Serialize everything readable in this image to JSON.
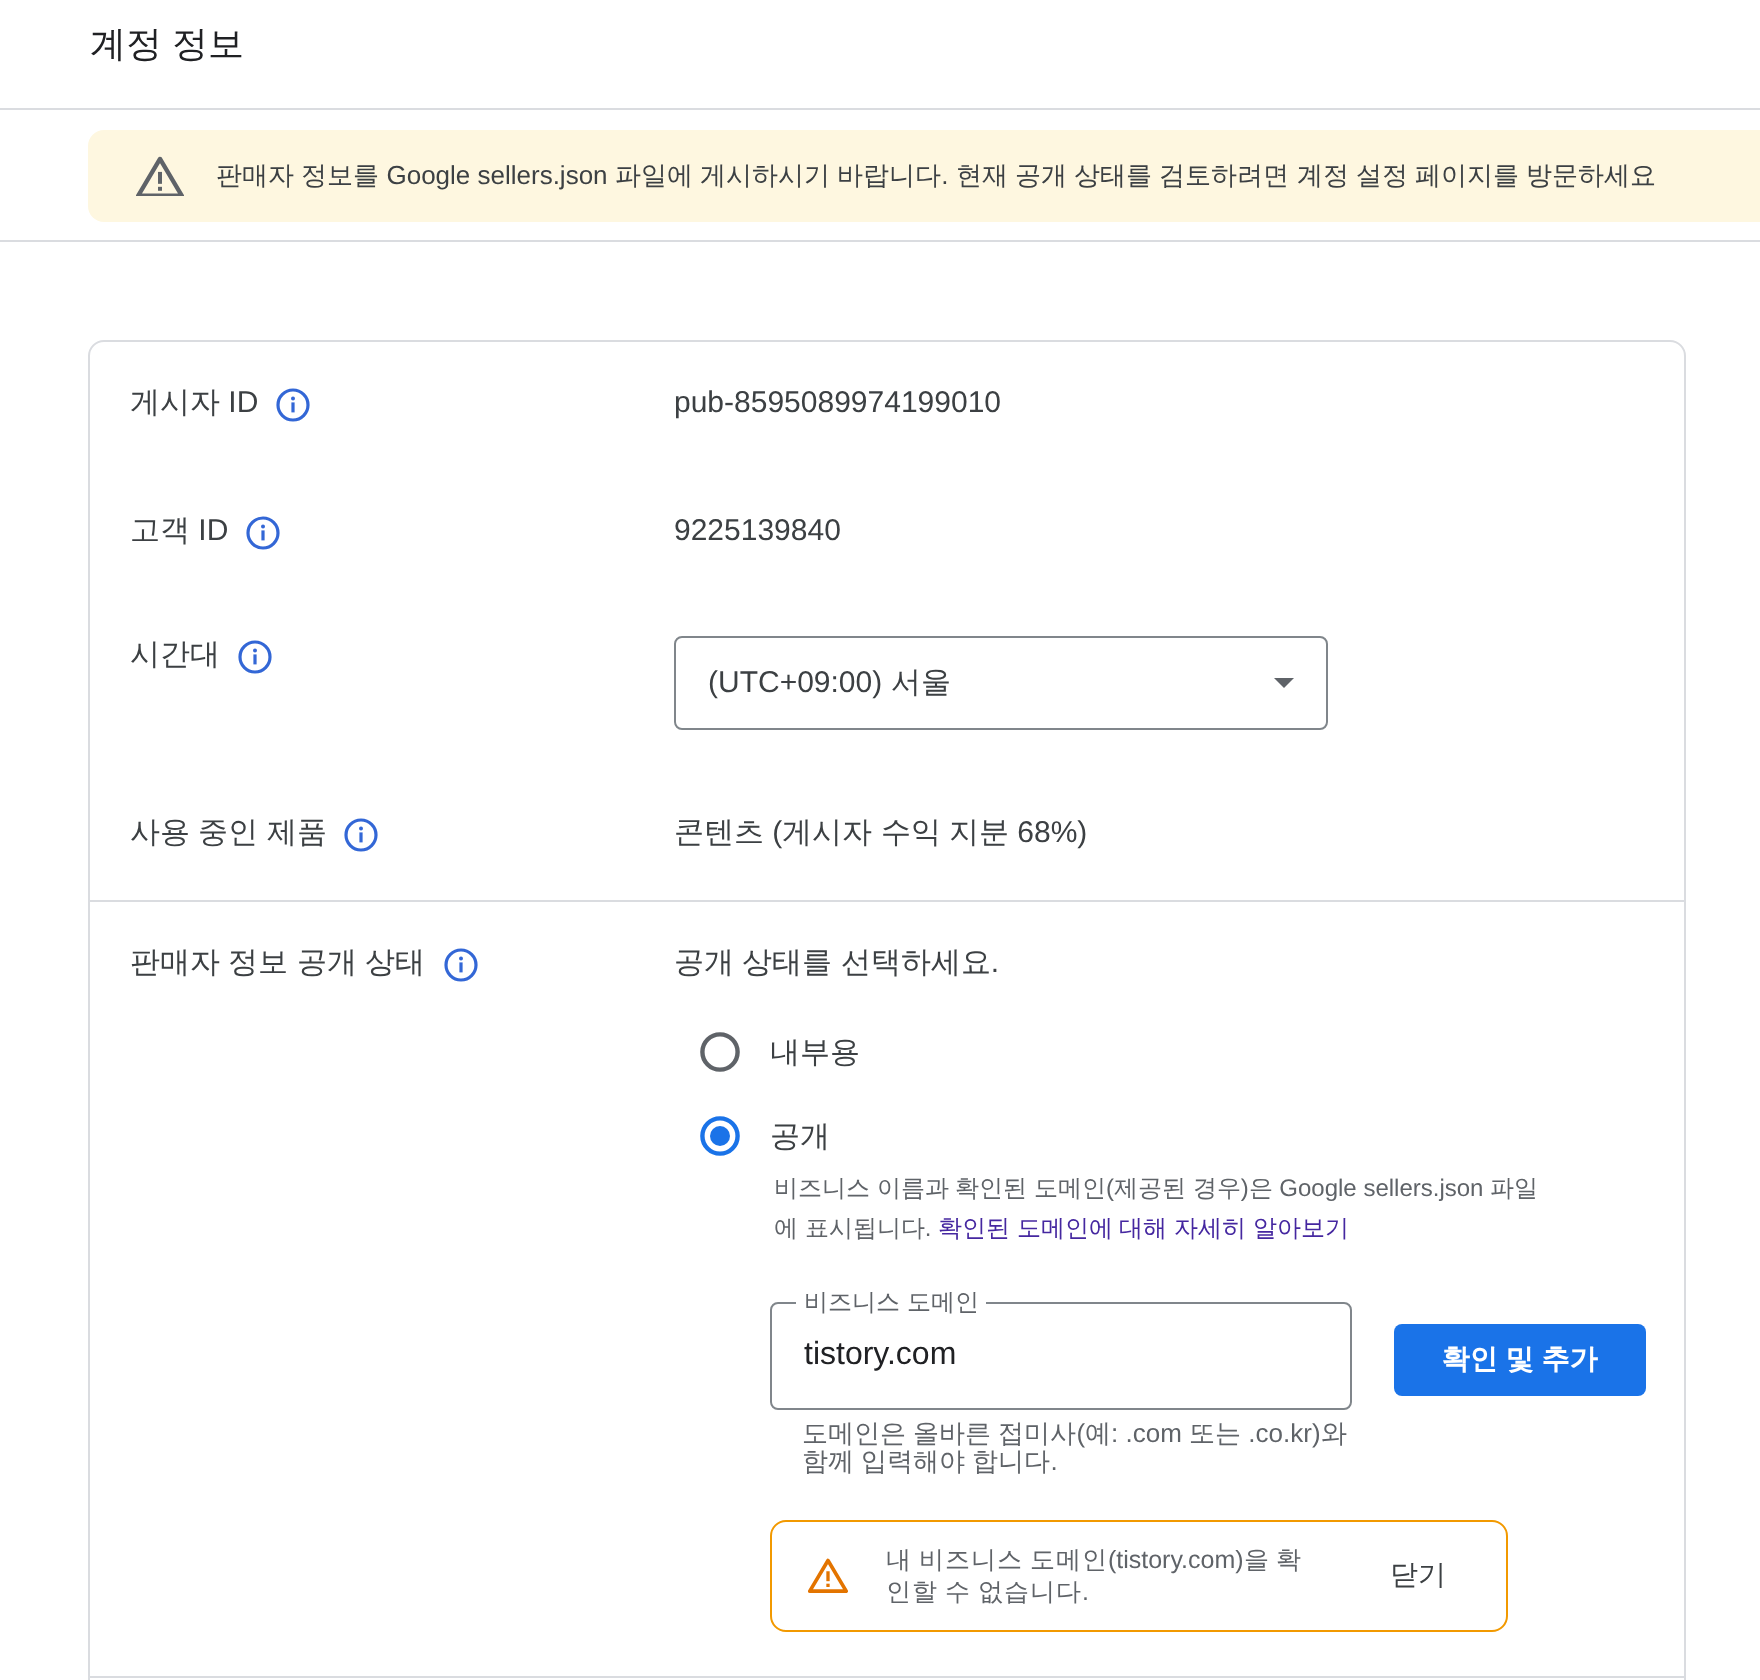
{
  "page": {
    "title": "계정 정보"
  },
  "banner": {
    "text": "판매자 정보를 Google sellers.json 파일에 게시하시기 바랍니다. 현재 공개 상태를 검토하려면 계정 설정 페이지를 방문하세요"
  },
  "info_rows": [
    {
      "label": "게시자 ID",
      "kind": "text",
      "value": "pub-8595089974199010"
    },
    {
      "label": "고객 ID",
      "kind": "text",
      "value": "9225139840"
    },
    {
      "label": "시간대",
      "kind": "select",
      "value": "(UTC+09:00) 서울"
    },
    {
      "label": "사용 중인 제품",
      "kind": "text",
      "value": "콘텐츠 (게시자 수익 지분 68%)"
    }
  ],
  "seller_visibility": {
    "label": "판매자 정보 공개 상태",
    "prompt": "공개 상태를 선택하세요.",
    "options": [
      {
        "label": "내부용",
        "selected": false
      },
      {
        "label": "공개",
        "selected": true,
        "description": "비즈니스 이름과 확인된 도메인(제공된 경우)은 Google sellers.json 파일에 표시됩니다.",
        "link": "확인된 도메인에 대해 자세히 알아보기"
      }
    ],
    "domain_field": {
      "label": "비즈니스 도메인",
      "value": "tistory.com",
      "helper": "도메인은 올바른 접미사(예: .com 또는 .co.kr)와 함께 입력해야 합니다."
    },
    "verify_button": "확인 및 추가",
    "alert": {
      "text": "내 비즈니스 도메인(tistory.com)을 확인할 수 없습니다.",
      "dismiss": "닫기"
    }
  }
}
